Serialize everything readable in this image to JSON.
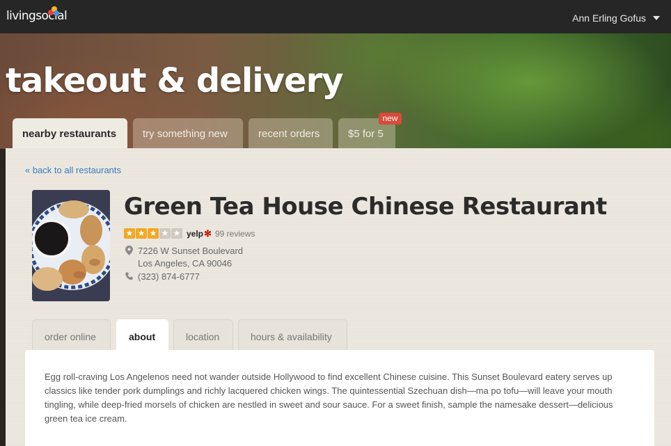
{
  "brand": {
    "name": "livingsocial",
    "dot_colors": [
      "#e8413a",
      "#f3b52b",
      "#4b8fd6",
      "#8fc23f"
    ]
  },
  "user": {
    "name": "Ann Erling Gofus",
    "menu_icon": "caret-down-icon"
  },
  "hero": {
    "title": "takeout & delivery"
  },
  "main_tabs": [
    {
      "label": "nearby restaurants",
      "active": true
    },
    {
      "label": "try something new",
      "active": false
    },
    {
      "label": "recent orders",
      "active": false
    },
    {
      "label": "$5 for 5",
      "active": false,
      "badge": "new"
    }
  ],
  "back_link": "« back to all restaurants",
  "restaurant": {
    "name": "Green Tea House Chinese Restaurant",
    "rating": 3,
    "rating_max": 5,
    "rating_source": "yelp",
    "reviews": "99 reviews",
    "address_line1": "7226 W Sunset Boulevard",
    "address_line2": "Los Angeles, CA 90046",
    "phone": "(323) 874-6777",
    "photo_icon": "dumplings-photo"
  },
  "detail_tabs": [
    {
      "label": "order online",
      "active": false
    },
    {
      "label": "about",
      "active": true
    },
    {
      "label": "location",
      "active": false
    },
    {
      "label": "hours & availability",
      "active": false
    }
  ],
  "about": {
    "description": "Egg roll-craving Los Angelenos need not wander outside Hollywood to find excellent Chinese cuisine. This Sunset Boulevard eatery serves up classics like tender pork dumplings and richly lacquered chicken wings. The quintessential Szechuan dish—ma po tofu—will leave your mouth tingling, while deep-fried morsels of chicken are nestled in sweet and sour sauce. For a sweet finish, sample the namesake dessert—delicious green tea ice cream."
  },
  "colors": {
    "accent_link": "#3a7bbd",
    "star_on": "#f2a826",
    "badge": "#d84a3a"
  }
}
